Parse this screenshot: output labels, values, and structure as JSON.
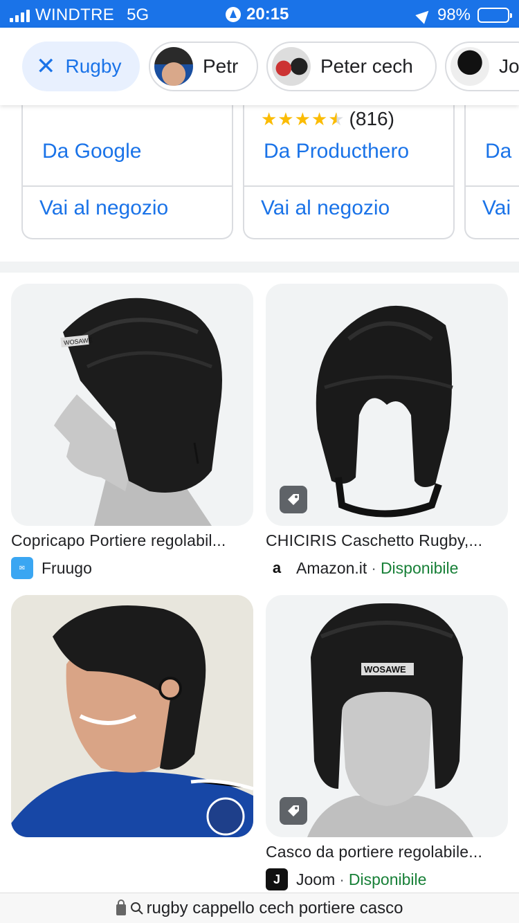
{
  "status_bar": {
    "carrier": "WINDTRE",
    "network": "5G",
    "time": "20:15",
    "battery": "98%"
  },
  "chips": [
    {
      "label": "Rugby",
      "active": true,
      "icon": "close-icon"
    },
    {
      "label": "Petr",
      "active": false
    },
    {
      "label": "Peter cech",
      "active": false
    },
    {
      "label": "Jo",
      "active": false
    }
  ],
  "shopping_cards": [
    {
      "rating": "",
      "reviews": "",
      "from": "Da Google",
      "shop_link": "Vai al negozio"
    },
    {
      "rating": 4.5,
      "reviews": "(816)",
      "from": "Da Producthero",
      "shop_link": "Vai al negozio"
    },
    {
      "rating": "",
      "reviews": "",
      "from": "Da",
      "shop_link": "Vai"
    }
  ],
  "products": [
    {
      "title": "Copricapo Portiere regolabil...",
      "seller": "Fruugo",
      "availability": "",
      "tag_icon": false
    },
    {
      "title": "CHICIRIS Caschetto Rugby,...",
      "seller": "Amazon.it",
      "availability": "Disponibile",
      "tag_icon": true
    },
    {
      "title": "",
      "seller": "",
      "availability": "",
      "tag_icon": false
    },
    {
      "title": "Casco da portiere regolabile...",
      "seller": "Joom",
      "availability": "Disponibile",
      "tag_icon": true
    }
  ],
  "helmet_brand_text": "WOSAWE",
  "url_bar": {
    "text": "rugby cappello cech portiere casco"
  },
  "colors": {
    "accent": "#1a73e8",
    "available": "#188038",
    "star": "#fbbc04"
  }
}
